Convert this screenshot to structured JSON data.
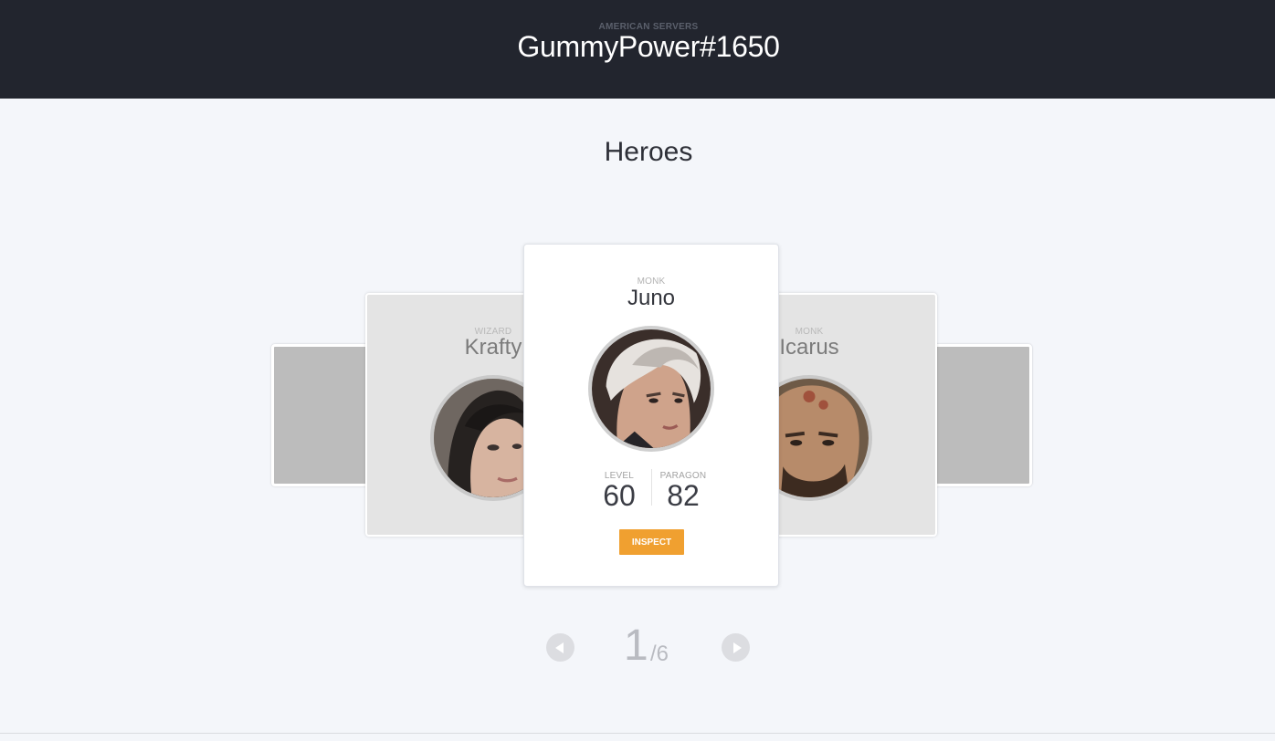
{
  "header": {
    "server_label": "AMERICAN SERVERS",
    "account_name": "GummyPower#1650"
  },
  "section": {
    "title": "Heroes"
  },
  "heroes": {
    "left": {
      "class": "WIZARD",
      "name": "Krafty"
    },
    "main": {
      "class": "MONK",
      "name": "Juno",
      "level_label": "LEVEL",
      "level": "60",
      "paragon_label": "PARAGON",
      "paragon": "82",
      "inspect_label": "INSPECT"
    },
    "right": {
      "class": "MONK",
      "name": "Icarus"
    }
  },
  "pager": {
    "current": "1",
    "total": "/6"
  },
  "colors": {
    "header_bg": "#22252e",
    "page_bg": "#f4f6fa",
    "accent": "#f0a030"
  },
  "icons": {
    "prev": "chevron-left-icon",
    "next": "chevron-right-icon"
  }
}
